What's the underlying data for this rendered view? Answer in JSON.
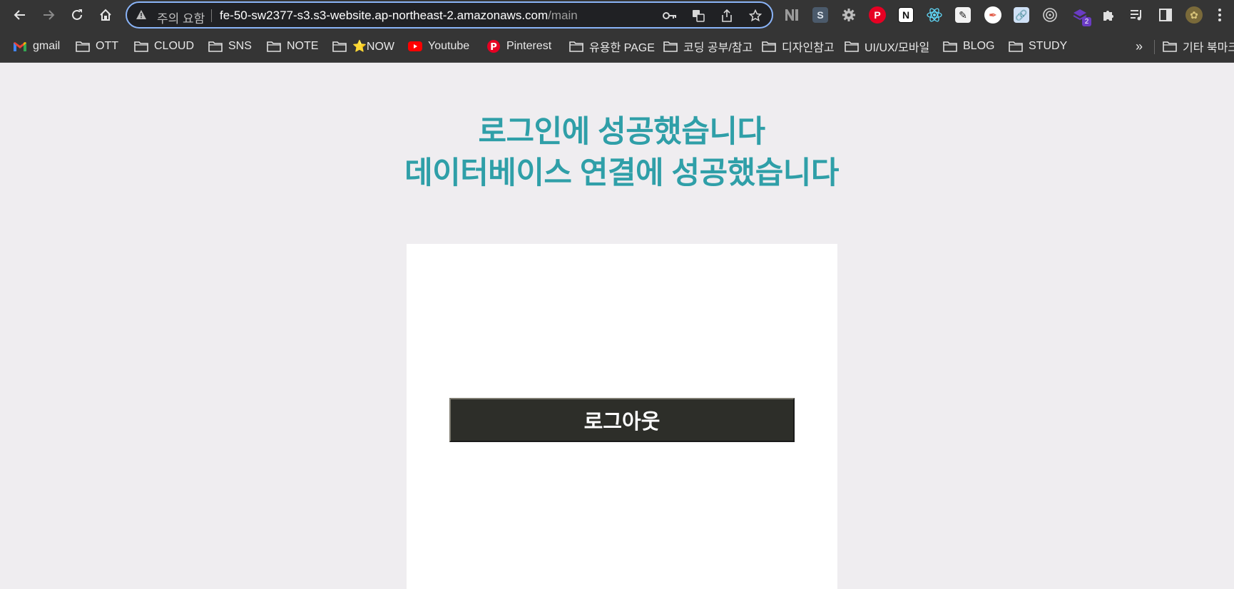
{
  "browser": {
    "security_label": "주의 요함",
    "url_host": "fe-50-sw2377-s3.s3-website.ap-northeast-2.amazonaws.com",
    "url_path": "/main",
    "extension_badge": "2"
  },
  "bookmarks": [
    {
      "label": "gmail",
      "icon": "gmail-icon"
    },
    {
      "label": "OTT",
      "icon": "folder-icon"
    },
    {
      "label": "CLOUD",
      "icon": "folder-icon"
    },
    {
      "label": "SNS",
      "icon": "folder-icon"
    },
    {
      "label": "NOTE",
      "icon": "folder-icon"
    },
    {
      "label": "⭐NOW",
      "icon": "folder-icon"
    },
    {
      "label": "Youtube",
      "icon": "youtube-icon"
    },
    {
      "label": "Pinterest",
      "icon": "pinterest-icon"
    },
    {
      "label": "유용한 PAGE",
      "icon": "folder-icon"
    },
    {
      "label": "코딩 공부/참고",
      "icon": "folder-icon"
    },
    {
      "label": "디자인참고",
      "icon": "folder-icon"
    },
    {
      "label": "UI/UX/모바일",
      "icon": "folder-icon"
    },
    {
      "label": "BLOG",
      "icon": "folder-icon"
    },
    {
      "label": "STUDY",
      "icon": "folder-icon"
    }
  ],
  "bookmarks_overflow": "»",
  "other_bookmarks": "기타 북마크",
  "page": {
    "heading_line1": "로그인에 성공했습니다",
    "heading_line2": "데이터베이스 연결에 성공했습니다",
    "logout_label": "로그아웃"
  },
  "colors": {
    "heading": "#2f9fa8",
    "button_bg": "#2d2e29",
    "page_bg": "#efedf0",
    "card_bg": "#ffffff"
  }
}
